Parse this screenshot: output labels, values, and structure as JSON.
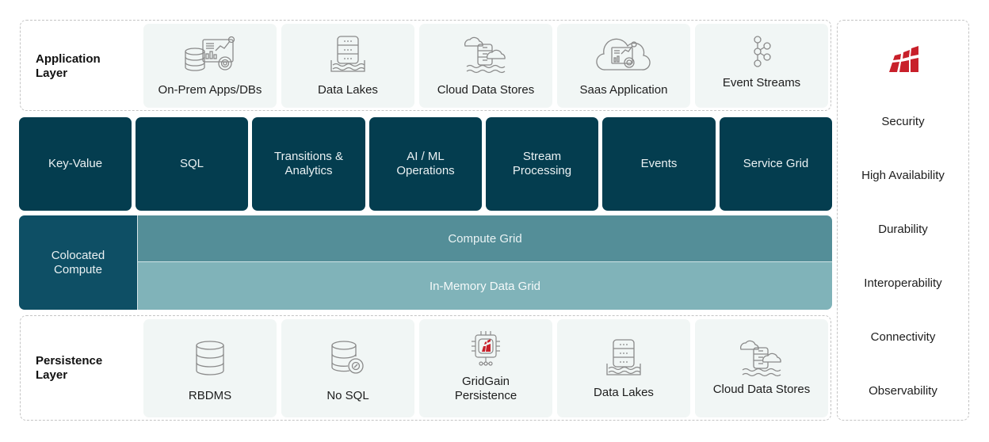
{
  "application_layer": {
    "title": "Application\nLayer",
    "title_line1": "Application",
    "title_line2": "Layer",
    "items": [
      {
        "label": "On-Prem Apps/DBs",
        "icon": "database-analytics-icon"
      },
      {
        "label": "Data Lakes",
        "icon": "data-lake-icon"
      },
      {
        "label": "Cloud Data Stores",
        "icon": "cloud-data-store-icon"
      },
      {
        "label": "Saas Application",
        "icon": "cloud-analytics-icon"
      },
      {
        "label": "Event Streams",
        "icon": "event-stream-icon"
      }
    ]
  },
  "capabilities": [
    {
      "line1": "Key-Value",
      "line2": ""
    },
    {
      "line1": "SQL",
      "line2": ""
    },
    {
      "line1": "Transitions &",
      "line2": "Analytics"
    },
    {
      "line1": "AI / ML",
      "line2": "Operations"
    },
    {
      "line1": "Stream",
      "line2": "Processing"
    },
    {
      "line1": "Events",
      "line2": ""
    },
    {
      "line1": "Service Grid",
      "line2": ""
    }
  ],
  "compute": {
    "colocated_line1": "Colocated",
    "colocated_line2": "Compute",
    "compute_grid": "Compute Grid",
    "in_memory_data_grid": "In-Memory Data Grid"
  },
  "persistence_layer": {
    "title_line1": "Persistence",
    "title_line2": "Layer",
    "items": [
      {
        "line1": "RBDMS",
        "line2": "",
        "icon": "database-icon"
      },
      {
        "line1": "No SQL",
        "line2": "",
        "icon": "database-gear-icon"
      },
      {
        "line1": "GridGain",
        "line2": "Persistence",
        "icon": "gridgain-chip-icon"
      },
      {
        "line1": "Data Lakes",
        "line2": "",
        "icon": "data-lake-icon"
      },
      {
        "line1": "Cloud Data Stores",
        "line2": "",
        "icon": "cloud-data-store-icon"
      }
    ]
  },
  "side_panel": {
    "logo": "gridgain-logo-icon",
    "items": [
      "Security",
      "High Availability",
      "Durability",
      "Interoperability",
      "Connectivity",
      "Observability"
    ]
  },
  "colors": {
    "dark_tile": "#043d4f",
    "colocated": "#0e4f65",
    "compute_grid": "#548e98",
    "imdg": "#80b3b9",
    "light_tile": "#f1f6f5",
    "brand_red": "#c8202a"
  }
}
